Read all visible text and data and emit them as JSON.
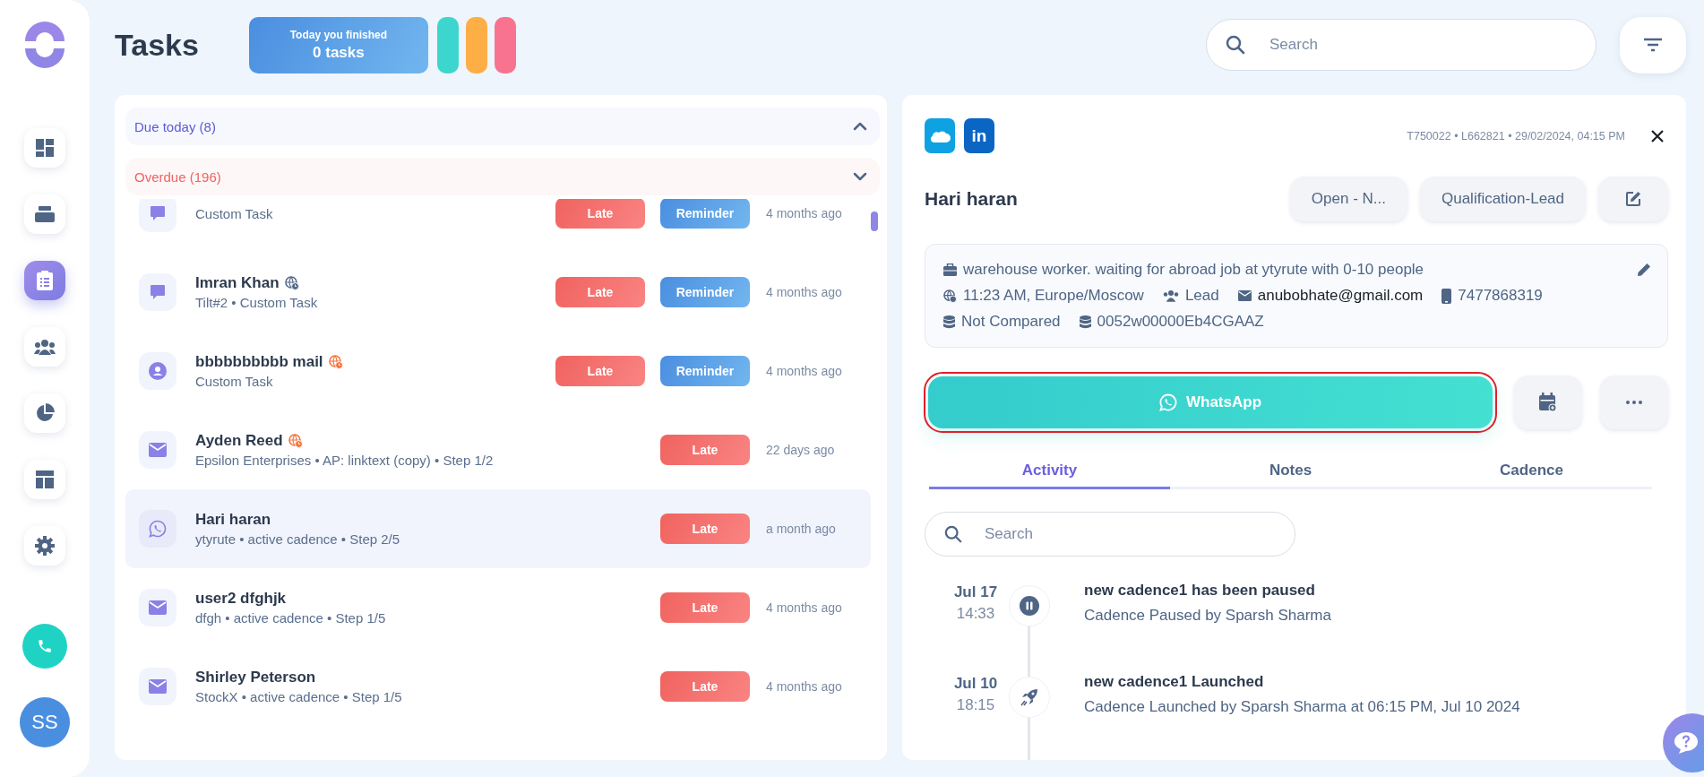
{
  "sidebar": {
    "items": [
      {
        "kind": "dashboard",
        "selected": false
      },
      {
        "kind": "inbox",
        "selected": false
      },
      {
        "kind": "tasks",
        "selected": true
      },
      {
        "kind": "team",
        "selected": false
      },
      {
        "kind": "reports",
        "selected": false
      },
      {
        "kind": "layout",
        "selected": false
      },
      {
        "kind": "settings",
        "selected": false
      }
    ],
    "avatar": {
      "initials": "SS"
    }
  },
  "header": {
    "title": "Tasks",
    "summary": {
      "label": "Today you finished",
      "count": "0 tasks"
    },
    "quick_filters": [
      {
        "color": "#3dd6cf"
      },
      {
        "color": "#fdae45"
      },
      {
        "color": "#f87390"
      }
    ],
    "search": {
      "placeholder": "Search"
    }
  },
  "task_list": {
    "sections": [
      {
        "label": "Due today (8)",
        "color": "#5b5bd6",
        "expanded": true
      },
      {
        "label": "Overdue (196)",
        "color": "#f0635f",
        "expanded": false
      }
    ],
    "rows": [
      {
        "kind": "chat",
        "subtitle": "Custom Task",
        "badges": [
          {
            "kind": "late",
            "label": "Late"
          },
          {
            "kind": "reminder",
            "label": "Reminder"
          }
        ],
        "time": "4 months ago",
        "selected": false
      },
      {
        "kind": "chat",
        "title": "Imran Khan",
        "timezone_alert": false,
        "subtitle": "Tilt#2 • Custom Task",
        "badges": [
          {
            "kind": "late",
            "label": "Late"
          },
          {
            "kind": "reminder",
            "label": "Reminder"
          }
        ],
        "time": "4 months ago",
        "selected": false
      },
      {
        "kind": "person",
        "title": "bbbbbbbbbb mail",
        "timezone_alert": true,
        "subtitle": "Custom Task",
        "badges": [
          {
            "kind": "late",
            "label": "Late"
          },
          {
            "kind": "reminder",
            "label": "Reminder"
          }
        ],
        "time": "4 months ago",
        "selected": false
      },
      {
        "kind": "email",
        "title": "Ayden Reed",
        "timezone_alert": true,
        "subtitle": "Epsilon Enterprises • AP: linktext (copy) • Step 1/2",
        "badges": [
          {
            "kind": "late",
            "label": "Late"
          }
        ],
        "time": "22 days ago",
        "selected": false
      },
      {
        "kind": "whatsapp",
        "title": "Hari haran",
        "subtitle": "ytyrute • active cadence • Step 2/5",
        "badges": [
          {
            "kind": "late",
            "label": "Late"
          }
        ],
        "time": "a month ago",
        "selected": true
      },
      {
        "kind": "email",
        "title": "user2 dfghjk",
        "subtitle": "dfgh • active cadence • Step 1/5",
        "badges": [
          {
            "kind": "late",
            "label": "Late"
          }
        ],
        "time": "4 months ago",
        "selected": false
      },
      {
        "kind": "email",
        "title": "Shirley Peterson",
        "subtitle": "StockX • active cadence • Step 1/5",
        "badges": [
          {
            "kind": "late",
            "label": "Late"
          }
        ],
        "time": "4 months ago",
        "selected": false
      }
    ]
  },
  "detail": {
    "sources": [
      {
        "kind": "salesforce"
      },
      {
        "kind": "linkedin",
        "label": "in"
      }
    ],
    "meta": "T750022 • L662821 • 29/02/2024, 04:15 PM",
    "name": "Hari haran",
    "status_buttons": [
      "Open - N...",
      "Qualification-Lead"
    ],
    "info": {
      "job": "warehouse worker. waiting for abroad job at ytyrute with 0-10 people",
      "local_time": "11:23 AM, Europe/Moscow",
      "role": "Lead",
      "email": "anubobhate@gmail.com",
      "phone": "7477868319",
      "compare": "Not Compared",
      "record_id": "0052w00000Eb4CGAAZ"
    },
    "primary_action": {
      "label": "WhatsApp",
      "focused": true
    },
    "tabs": [
      {
        "label": "Activity",
        "selected": true
      },
      {
        "label": "Notes",
        "selected": false
      },
      {
        "label": "Cadence",
        "selected": false
      }
    ],
    "search": {
      "placeholder": "Search"
    },
    "timeline": [
      {
        "kind": "paused",
        "date": "Jul 17",
        "time": "14:33",
        "title": "new cadence1 has been paused",
        "text": "Cadence Paused by Sparsh Sharma"
      },
      {
        "kind": "launched",
        "date": "Jul 10",
        "time": "18:15",
        "title": "new cadence1 Launched",
        "text": "Cadence Launched by Sparsh Sharma at 06:15 PM, Jul 10 2024"
      }
    ]
  }
}
